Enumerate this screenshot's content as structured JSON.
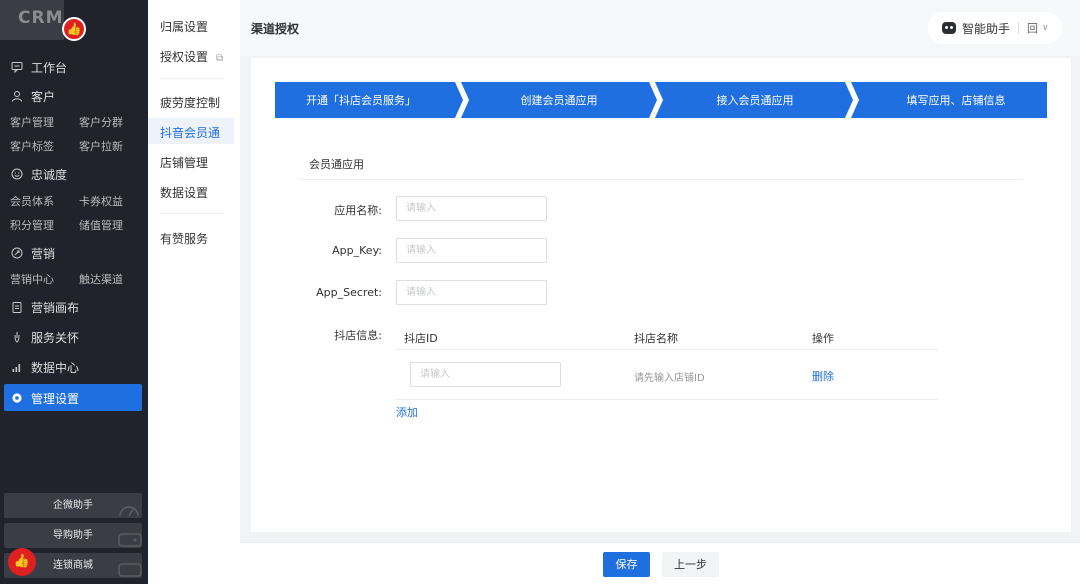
{
  "nav": {
    "logo_text": "CRM",
    "items": [
      {
        "label": "工作台",
        "icon": "chat-icon"
      },
      {
        "label": "客户",
        "icon": "user-icon"
      },
      {
        "label": "忠诚度",
        "icon": "smile-icon"
      },
      {
        "label": "营销",
        "icon": "target-icon"
      },
      {
        "label": "营销画布",
        "icon": "clipboard-icon"
      },
      {
        "label": "服务关怀",
        "icon": "bulb-icon"
      },
      {
        "label": "数据中心",
        "icon": "bar-chart-icon"
      },
      {
        "label": "管理设置",
        "icon": "gear-icon"
      }
    ],
    "sub": {
      "customer": [
        "客户管理",
        "客户分群",
        "客户标签",
        "客户拉新"
      ],
      "loyalty": [
        "会员体系",
        "卡券权益",
        "积分管理",
        "储值管理"
      ],
      "marketing": [
        "营销中心",
        "触达渠道"
      ]
    },
    "bottom_buttons": [
      "企微助手",
      "导购助手",
      "连锁商城"
    ]
  },
  "submenu": {
    "items": [
      "归属设置",
      "授权设置",
      "疲劳度控制",
      "抖音会员通",
      "店铺管理",
      "数据设置",
      "有赞服务"
    ],
    "active": "抖音会员通"
  },
  "header": {
    "title": "渠道授权",
    "assistant_label": "智能助手",
    "shop_label": "回"
  },
  "steps": [
    "开通「抖店会员服务」",
    "创建会员通应用",
    "接入会员通应用",
    "填写应用、店铺信息"
  ],
  "form": {
    "section_title": "会员通应用",
    "app_name_label": "应用名称:",
    "app_key_label": "App_Key:",
    "app_secret_label": "App_Secret:",
    "placeholder": "请输入",
    "shop_info_label": "抖店信息:",
    "table": {
      "columns": [
        "抖店ID",
        "抖店名称",
        "操作"
      ],
      "row": {
        "id_placeholder": "请输入",
        "name_hint": "请先输入店铺ID",
        "action": "删除"
      }
    },
    "add_label": "添加"
  },
  "footer": {
    "save_label": "保存",
    "prev_label": "上一步"
  },
  "colors": {
    "primary": "#1f6fe0",
    "nav_bg": "#20232b",
    "badge_red": "#e02020"
  }
}
